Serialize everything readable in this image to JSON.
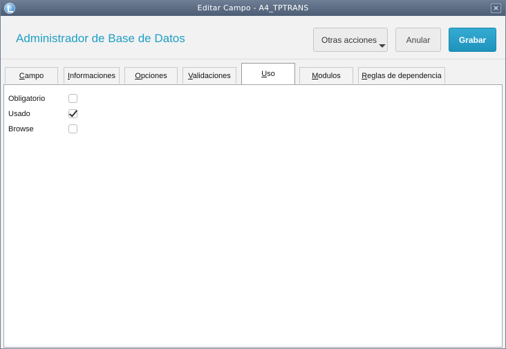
{
  "window": {
    "title": "Editar Campo - A4_TPTRANS",
    "close_glyph": "×"
  },
  "header": {
    "title": "Administrador de Base de Datos",
    "buttons": {
      "otras": "Otras acciones",
      "anular": "Anular",
      "grabar": "Grabar"
    }
  },
  "tabs": [
    {
      "label": "Campo"
    },
    {
      "label": "Informaciones"
    },
    {
      "label": "Opciones"
    },
    {
      "label": "Validaciones"
    },
    {
      "label": "Uso",
      "active": true
    },
    {
      "label": "Modulos"
    },
    {
      "label": "Reglas de dependencia"
    }
  ],
  "fields": [
    {
      "label": "Obligatorio",
      "checked": false
    },
    {
      "label": "Usado",
      "checked": true
    },
    {
      "label": "Browse",
      "checked": false
    }
  ],
  "icons": {
    "app": "app-logo-icon",
    "close": "close-icon",
    "dropdown": "chevron-down-icon"
  },
  "colors": {
    "title_blue": "#1f9fc4",
    "grabar_bg": "#2aa3cc",
    "titlebar": "#5d6d84"
  }
}
